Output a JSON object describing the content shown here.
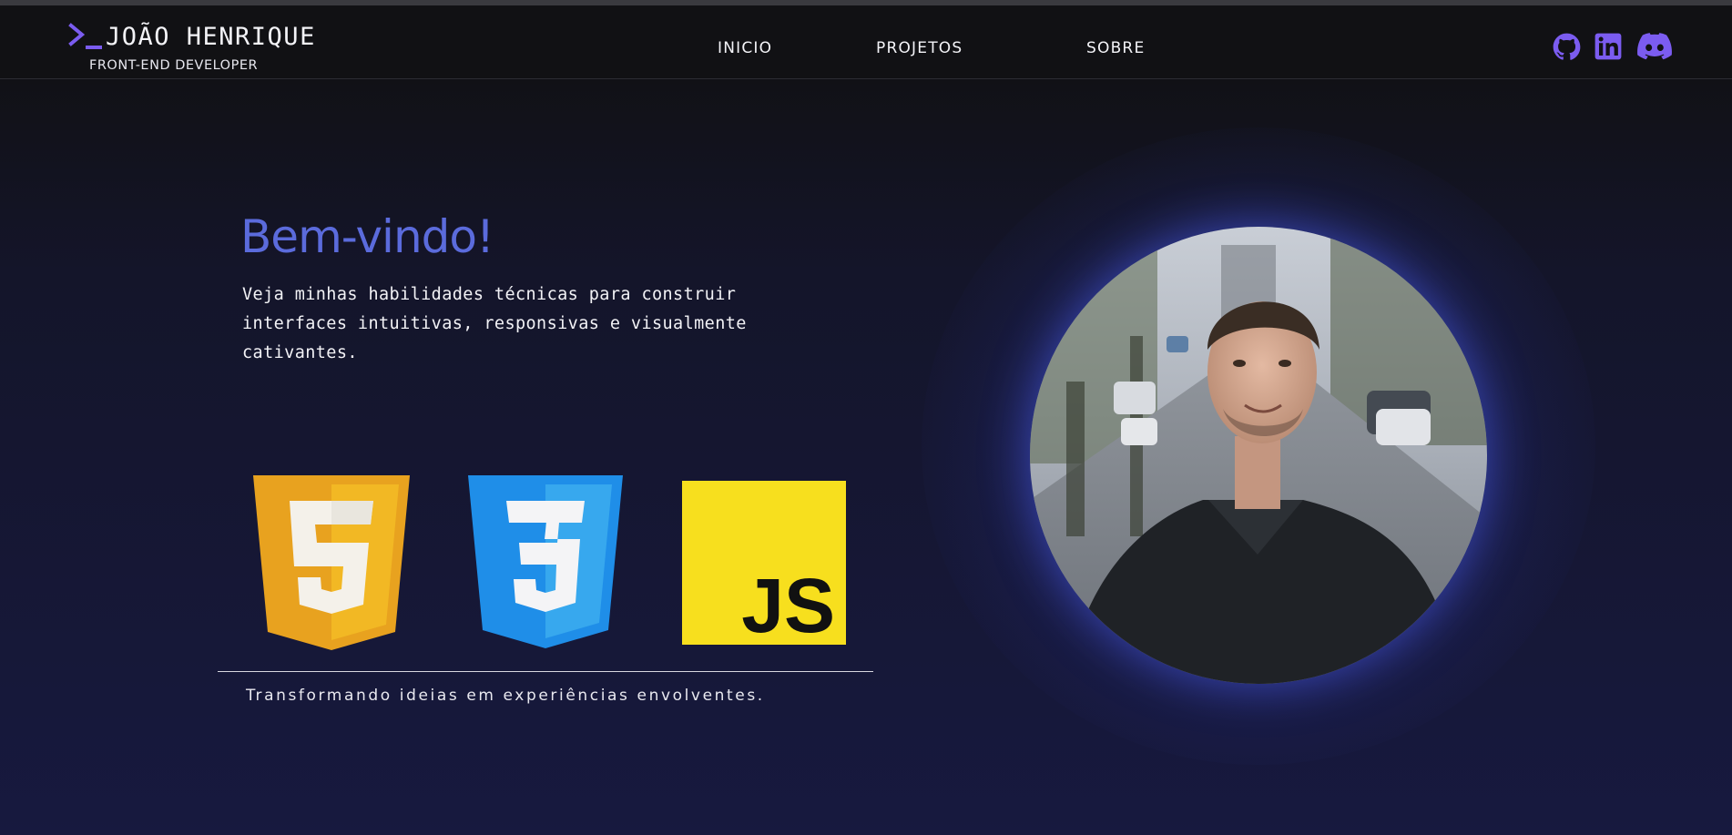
{
  "header": {
    "brand_name": "JOÃO HENRIQUE",
    "brand_role": "FRONT-END DEVELOPER",
    "nav": [
      {
        "label": "INICIO"
      },
      {
        "label": "PROJETOS"
      },
      {
        "label": "SOBRE"
      }
    ],
    "social": [
      {
        "icon": "github-icon"
      },
      {
        "icon": "linkedin-icon"
      },
      {
        "icon": "discord-icon"
      }
    ]
  },
  "hero": {
    "title": "Bem-vindo!",
    "subtitle": "Veja minhas habilidades técnicas para construir interfaces intuitivas, responsivas e visualmente cativantes.",
    "skills": [
      {
        "icon": "html5-icon",
        "number": "5"
      },
      {
        "icon": "css3-icon",
        "number": "3"
      },
      {
        "icon": "javascript-icon",
        "label": "JS"
      }
    ],
    "tagline": "Transformando ideias em experiências envolventes."
  },
  "photo": {
    "subject": "profile-photo"
  },
  "colors": {
    "accent": "#5b6bdc",
    "icon_purple": "#7b5cf0",
    "html5_orange": "#e8a21f",
    "css3_blue": "#1f8ee8",
    "js_yellow": "#f7df1e",
    "background_top": "#111116",
    "background_bottom": "#17193f"
  }
}
